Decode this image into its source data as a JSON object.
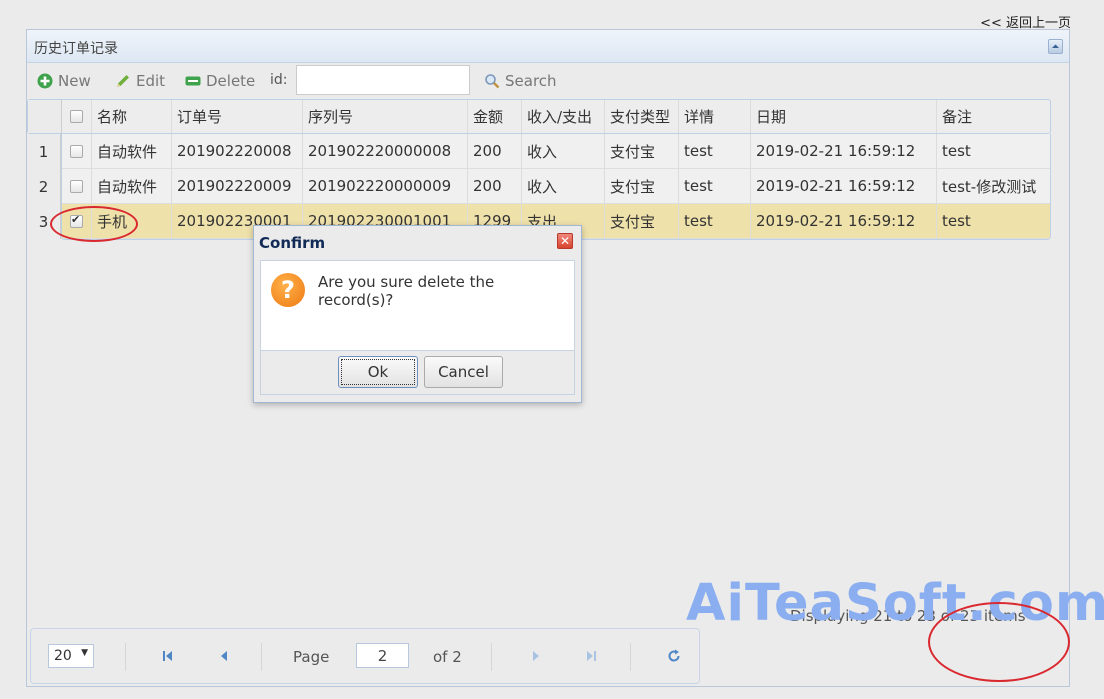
{
  "back_link": "<< 返回上一页",
  "panel": {
    "title": "历史订单记录"
  },
  "toolbar": {
    "new_label": "New",
    "edit_label": "Edit",
    "delete_label": "Delete",
    "id_label": "id:",
    "id_value": "",
    "search_label": "Search"
  },
  "grid": {
    "columns": [
      "名称",
      "订单号",
      "序列号",
      "金额",
      "收入/支出",
      "支付类型",
      "详情",
      "日期",
      "备注"
    ],
    "rows": [
      {
        "num": "1",
        "checked": false,
        "cells": [
          "自动软件",
          "201902220008",
          "201902220000008",
          "200",
          "收入",
          "支付宝",
          "test",
          "2019-02-21 16:59:12",
          "test"
        ]
      },
      {
        "num": "2",
        "checked": false,
        "cells": [
          "自动软件",
          "201902220009",
          "201902220000009",
          "200",
          "收入",
          "支付宝",
          "test",
          "2019-02-21 16:59:12",
          "test-修改测试"
        ]
      },
      {
        "num": "3",
        "checked": true,
        "cells": [
          "手机",
          "201902230001",
          "201902230001001",
          "1299",
          "支出",
          "支付宝",
          "test",
          "2019-02-21 16:59:12",
          "test"
        ]
      }
    ]
  },
  "pager": {
    "page_size": "20",
    "page_label": "Page",
    "page_value": "2",
    "of_label": "of 2",
    "display_info": "Displaying 21 to 23 of 23 items"
  },
  "watermark": "AiTeaSoft.com",
  "dialog": {
    "title": "Confirm",
    "message": "Are you sure delete the record(s)?",
    "ok_label": "Ok",
    "cancel_label": "Cancel"
  },
  "colors": {
    "accent": "#d9282f",
    "selected_row": "#efe1aa",
    "watermark": "#8aaef0"
  }
}
